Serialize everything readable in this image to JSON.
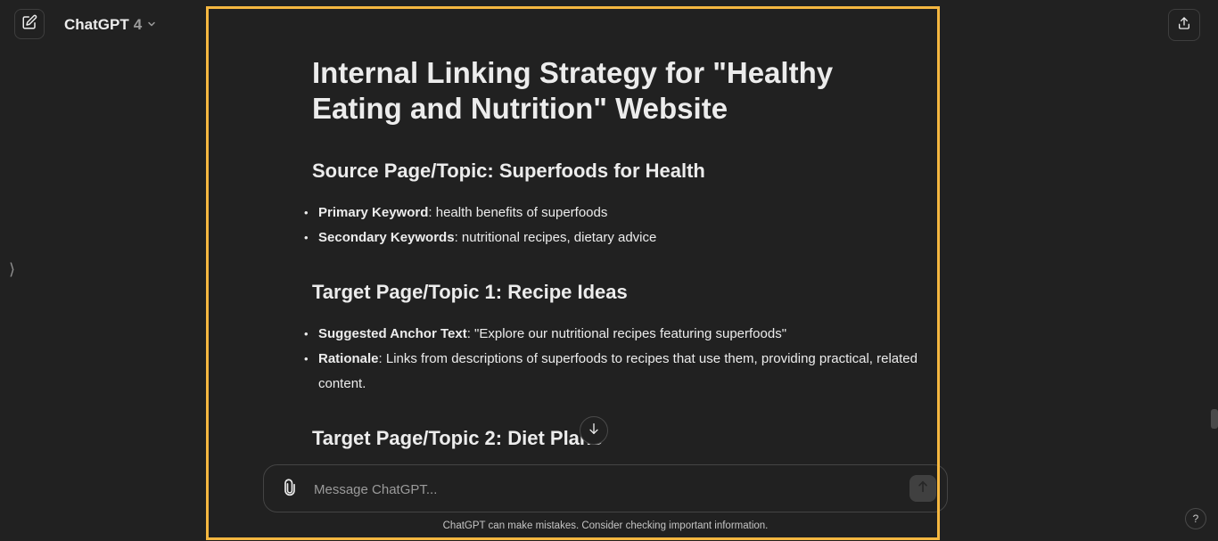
{
  "header": {
    "model_name": "ChatGPT",
    "model_version": "4"
  },
  "icons": {
    "new_chat": "pencil-square-icon",
    "model_dropdown": "chevron-down-icon",
    "share": "share-upload-icon",
    "sidebar_toggle": "chevron-right-icon",
    "scroll_down": "arrow-down-icon",
    "attach": "paperclip-icon",
    "send": "arrow-up-icon",
    "help": "question-mark-icon"
  },
  "sidebar_toggle_glyph": "⟩",
  "article": {
    "title": "Internal Linking Strategy for \"Healthy Eating and Nutrition\" Website",
    "source": {
      "heading": "Source Page/Topic: Superfoods for Health",
      "items": [
        {
          "label": "Primary Keyword",
          "text": ": health benefits of superfoods"
        },
        {
          "label": "Secondary Keywords",
          "text": ": nutritional recipes, dietary advice"
        }
      ]
    },
    "target1": {
      "heading": "Target Page/Topic 1: Recipe Ideas",
      "items": [
        {
          "label": "Suggested Anchor Text",
          "text": ": \"Explore our nutritional recipes featuring superfoods\""
        },
        {
          "label": "Rationale",
          "text": ": Links from descriptions of superfoods to recipes that use them, providing practical, related content."
        }
      ]
    },
    "target2": {
      "heading": "Target Page/Topic 2: Diet Plans"
    }
  },
  "composer": {
    "placeholder": "Message ChatGPT..."
  },
  "disclaimer": "ChatGPT can make mistakes. Consider checking important information.",
  "help_label": "?",
  "colors": {
    "background": "#212121",
    "text": "#ececec",
    "highlight_frame": "#f5b740"
  }
}
